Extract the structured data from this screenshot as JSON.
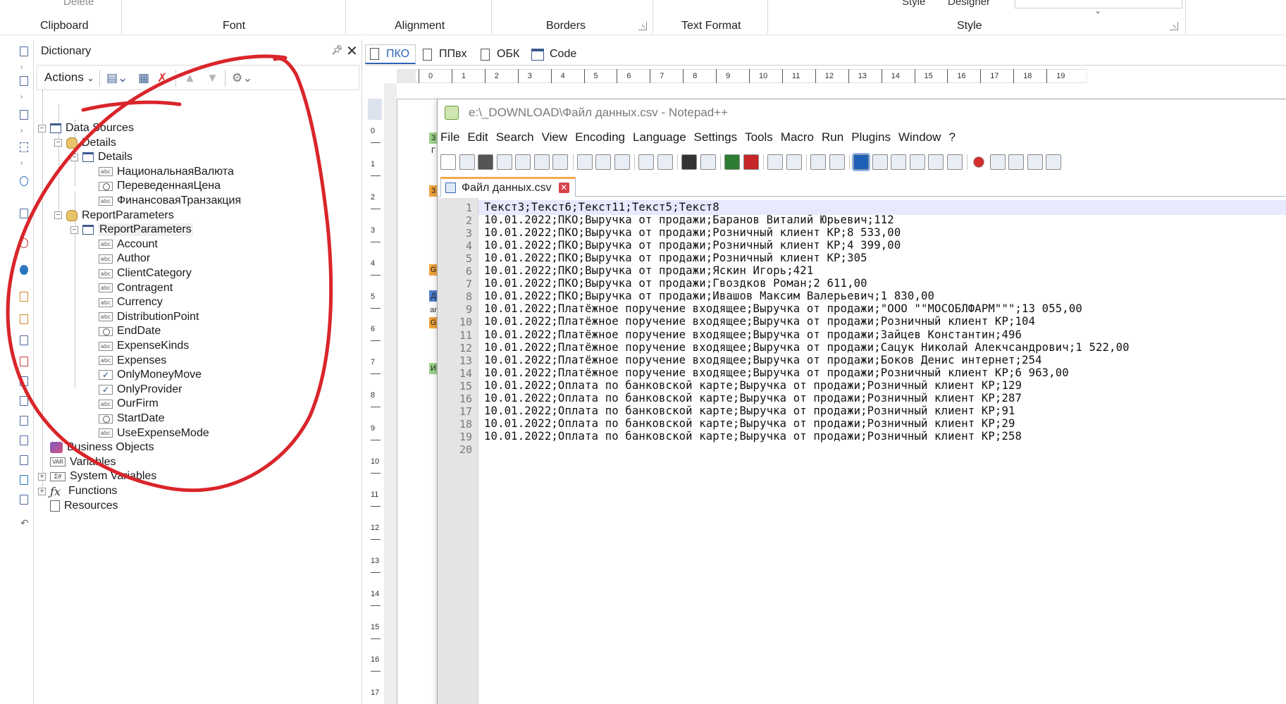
{
  "ribbon": {
    "fragments": [
      "Delete",
      "Style",
      "Designer"
    ],
    "groups": [
      "Clipboard",
      "Font",
      "Alignment",
      "Borders",
      "Text Format",
      "Style"
    ]
  },
  "dictionary": {
    "title": "Dictionary",
    "actions_label": "Actions",
    "tree": [
      {
        "label": "Data Sources",
        "icon": "table-icon"
      },
      {
        "label": "Details",
        "icon": "database-icon"
      },
      {
        "label": "Details",
        "icon": "table-icon"
      },
      {
        "label": "НациональнаяВалюта",
        "icon": "abc-icon"
      },
      {
        "label": "ПереведеннаяЦена",
        "icon": "ref-icon"
      },
      {
        "label": "ФинансоваяТранзакция",
        "icon": "abc-icon"
      },
      {
        "label": "ReportParameters",
        "icon": "database-icon"
      },
      {
        "label": "ReportParameters",
        "icon": "table-icon"
      },
      {
        "label": "Account",
        "icon": "abc-icon"
      },
      {
        "label": "Author",
        "icon": "abc-icon"
      },
      {
        "label": "ClientCategory",
        "icon": "abc-icon"
      },
      {
        "label": "Contragent",
        "icon": "abc-icon"
      },
      {
        "label": "Currency",
        "icon": "abc-icon"
      },
      {
        "label": "DistributionPoint",
        "icon": "abc-icon"
      },
      {
        "label": "EndDate",
        "icon": "clock-icon"
      },
      {
        "label": "ExpenseKinds",
        "icon": "abc-icon"
      },
      {
        "label": "Expenses",
        "icon": "abc-icon"
      },
      {
        "label": "OnlyMoneyMove",
        "icon": "checkbox-icon"
      },
      {
        "label": "OnlyProvider",
        "icon": "checkbox-icon"
      },
      {
        "label": "OurFirm",
        "icon": "abc-icon"
      },
      {
        "label": "StartDate",
        "icon": "clock-icon"
      },
      {
        "label": "UseExpenseMode",
        "icon": "abc-icon"
      },
      {
        "label": "Business Objects",
        "icon": "cube-icon"
      },
      {
        "label": "Variables",
        "icon": "var-icon"
      },
      {
        "label": "System Variables",
        "icon": "sysvar-icon"
      },
      {
        "label": "Functions",
        "icon": "fx-icon"
      },
      {
        "label": "Resources",
        "icon": "doc-icon"
      }
    ]
  },
  "report_tabs": [
    "ПКО",
    "ППвх",
    "ОБК",
    "Code"
  ],
  "ruler": {
    "h_ticks": [
      "0",
      "1",
      "2",
      "3",
      "4",
      "5",
      "6",
      "7",
      "8",
      "9",
      "10",
      "11",
      "12",
      "13",
      "14",
      "15",
      "16",
      "17",
      "18",
      "19"
    ],
    "v_ticks": [
      "0",
      "1",
      "2",
      "3",
      "4",
      "5",
      "6",
      "7",
      "8",
      "9",
      "10",
      "11",
      "12",
      "13",
      "14",
      "15",
      "16",
      "17"
    ]
  },
  "band_marks": [
    "3",
    "Г",
    "3",
    "G",
    "Д",
    "ar",
    "G",
    "И"
  ],
  "notepad": {
    "title": "e:\\_DOWNLOAD\\Файл данных.csv - Notepad++",
    "menu": [
      "File",
      "Edit",
      "Search",
      "View",
      "Encoding",
      "Language",
      "Settings",
      "Tools",
      "Macro",
      "Run",
      "Plugins",
      "Window",
      "?"
    ],
    "tab_label": "Файл данных.csv",
    "tab_close_glyph": "✕",
    "lines": [
      "Текст3;Текст6;Текст11;Текст5;Текст8",
      "10.01.2022;ПКО;Выручка от продажи;Баранов Виталий Юрьевич;112",
      "10.01.2022;ПКО;Выручка от продажи;Розничный клиент КР;8 533,00",
      "10.01.2022;ПКО;Выручка от продажи;Розничный клиент КР;4 399,00",
      "10.01.2022;ПКО;Выручка от продажи;Розничный клиент КР;305",
      "10.01.2022;ПКО;Выручка от продажи;Яскин Игорь;421",
      "10.01.2022;ПКО;Выручка от продажи;Гвоздков Роман;2 611,00",
      "10.01.2022;ПКО;Выручка от продажи;Ивашов Максим Валерьевич;1 830,00",
      "10.01.2022;Платёжное поручение входящее;Выручка от продажи;\"ООО \"\"МОСОБЛФАРМ\"\"\";13 055,00",
      "10.01.2022;Платёжное поручение входящее;Выручка от продажи;Розничный клиент КР;104",
      "10.01.2022;Платёжное поручение входящее;Выручка от продажи;Зайцев Константин;496",
      "10.01.2022;Платёжное поручение входящее;Выручка от продажи;Сацук Николай Алекчсандрович;1 522,00",
      "10.01.2022;Платёжное поручение входящее;Выручка от продажи;Боков Денис интернет;254",
      "10.01.2022;Платёжное поручение входящее;Выручка от продажи;Розничный клиент КР;6 963,00",
      "10.01.2022;Оплата по банковской карте;Выручка от продажи;Розничный клиент КР;129",
      "10.01.2022;Оплата по банковской карте;Выручка от продажи;Розничный клиент КР;287",
      "10.01.2022;Оплата по банковской карте;Выручка от продажи;Розничный клиент КР;91",
      "10.01.2022;Оплата по банковской карте;Выручка от продажи;Розничный клиент КР;29",
      "10.01.2022;Оплата по банковской карте;Выручка от продажи;Розничный клиент КР;258",
      ""
    ],
    "line_numbers": [
      "1",
      "2",
      "3",
      "4",
      "5",
      "6",
      "7",
      "8",
      "9",
      "10",
      "11",
      "12",
      "13",
      "14",
      "15",
      "16",
      "17",
      "18",
      "19",
      "20"
    ]
  },
  "colors": {
    "annotation": "#d9252b",
    "tab_active": "#2b63b8",
    "npp_tab_accent": "#f2a94d",
    "current_line": "#e8e8ff"
  }
}
